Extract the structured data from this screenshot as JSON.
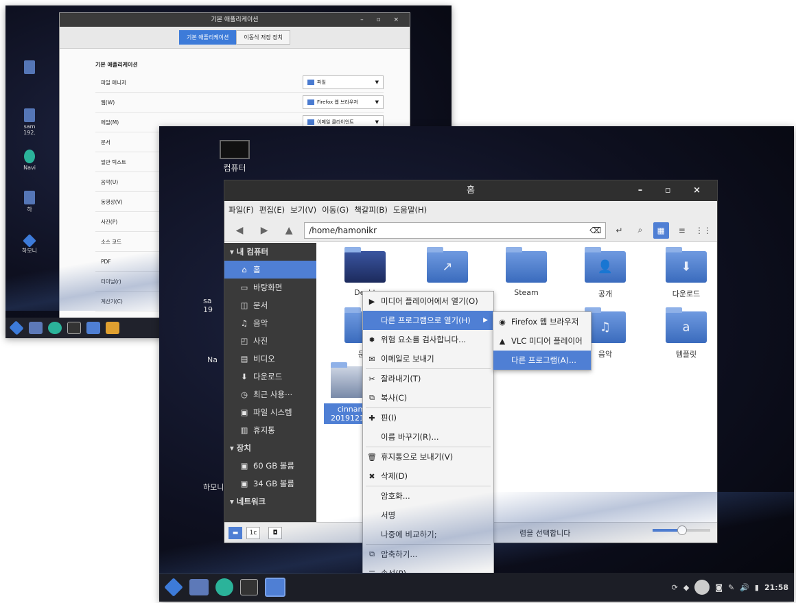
{
  "back": {
    "window_title": "기본 애플리케이션",
    "controls": "– ▫ ×",
    "tabs": [
      "기본 애플리케이션",
      "이동식 저장 장치"
    ],
    "section_title": "기본 애플리케이션",
    "rows": [
      {
        "label": "파일 매니저",
        "value": "파일"
      },
      {
        "label": "웹(W)",
        "value": "Firefox 웹 브라우저"
      },
      {
        "label": "메일(M)",
        "value": "이메일 클라이언트"
      },
      {
        "label": "문서",
        "value": ""
      },
      {
        "label": "일반 텍스트",
        "value": ""
      },
      {
        "label": "음악(U)",
        "value": ""
      },
      {
        "label": "동영상(V)",
        "value": ""
      },
      {
        "label": "사진(P)",
        "value": ""
      },
      {
        "label": "소스 코드",
        "value": ""
      },
      {
        "label": "PDF",
        "value": ""
      },
      {
        "label": "터미널(r)",
        "value": ""
      },
      {
        "label": "계산기(C)",
        "value": ""
      }
    ],
    "desktop_icons": [
      "sam",
      "192.",
      "Navi",
      "하",
      "하모니"
    ]
  },
  "front": {
    "desktop_computer_label": "컴퓨터",
    "desktop_side_labels": [
      "sa",
      "19",
      "Na",
      "하모니"
    ],
    "title": "홈",
    "controls": "– ▫ ×",
    "menu": [
      "파일(F)",
      "편집(E)",
      "보기(V)",
      "이동(G)",
      "책갈피(B)",
      "도움말(H)"
    ],
    "path": "/home/hamonikr",
    "sidebar": {
      "heading_computer": "내 컴퓨터",
      "computer_items": [
        {
          "icon": "⌂",
          "label": "홈"
        },
        {
          "icon": "▭",
          "label": "바탕화면"
        },
        {
          "icon": "◫",
          "label": "문서"
        },
        {
          "icon": "♫",
          "label": "음악"
        },
        {
          "icon": "◰",
          "label": "사진"
        },
        {
          "icon": "▤",
          "label": "비디오"
        },
        {
          "icon": "⬇",
          "label": "다운로드"
        },
        {
          "icon": "◷",
          "label": "최근 사용⋯"
        },
        {
          "icon": "▣",
          "label": "파일 시스템"
        },
        {
          "icon": "▥",
          "label": "휴지통"
        }
      ],
      "heading_devices": "장치",
      "device_items": [
        {
          "icon": "▣",
          "label": "60 GB 볼륨"
        },
        {
          "icon": "▣",
          "label": "34 GB 볼륨"
        }
      ],
      "heading_network": "네트워크"
    },
    "files": [
      {
        "name": "Deskt",
        "glyph": ""
      },
      {
        "name": "",
        "glyph": "↗"
      },
      {
        "name": "Steam",
        "glyph": ""
      },
      {
        "name": "공개",
        "glyph": "👤"
      },
      {
        "name": "다운로드",
        "glyph": "⬇"
      },
      {
        "name": "문서",
        "glyph": ""
      },
      {
        "name": "음악",
        "glyph": "♫"
      },
      {
        "name": "템플릿",
        "glyph": "a"
      },
      {
        "name": "cinnam 20191212-",
        "glyph": ""
      }
    ],
    "status_text": "렴을 선택합니다",
    "status_buttons": [
      "▬",
      "1c",
      "◘"
    ],
    "context_menu": [
      {
        "icon": "▶",
        "label": "미디어 플레이어에서 열기(O)"
      },
      {
        "icon": "",
        "label": "다른 프로그램으로 열기(H)",
        "arrow": "▶"
      },
      {
        "icon": "✹",
        "label": "위험 요소를 검사합니다..."
      },
      {
        "icon": "✉",
        "label": "이메일로 보내기"
      },
      {
        "icon": "✂",
        "label": "잘라내기(T)"
      },
      {
        "icon": "⧉",
        "label": "복사(C)"
      },
      {
        "icon": "✚",
        "label": "핀(I)"
      },
      {
        "icon": "",
        "label": "이름 바꾸기(R)..."
      },
      {
        "icon": "🗑",
        "label": "휴지통으로 보내기(V)"
      },
      {
        "icon": "✖",
        "label": "삭제(D)"
      },
      {
        "icon": "",
        "label": "암호화..."
      },
      {
        "icon": "",
        "label": "서명"
      },
      {
        "icon": "",
        "label": "나중에 비교하기;"
      },
      {
        "icon": "⧉",
        "label": "압축하기..."
      },
      {
        "icon": "☰",
        "label": "속성(P)"
      }
    ],
    "submenu": [
      {
        "icon": "◉",
        "label": "Firefox 웹 브라우저"
      },
      {
        "icon": "▲",
        "label": "VLC 미디어 플레이어"
      },
      {
        "icon": "",
        "label": "다른 프로그램(A)..."
      }
    ],
    "clock": "21:58"
  },
  "colors": {
    "accent": "#4f7fd4",
    "panel": "#3a3a3a",
    "titlebar": "#2f2f2f"
  }
}
